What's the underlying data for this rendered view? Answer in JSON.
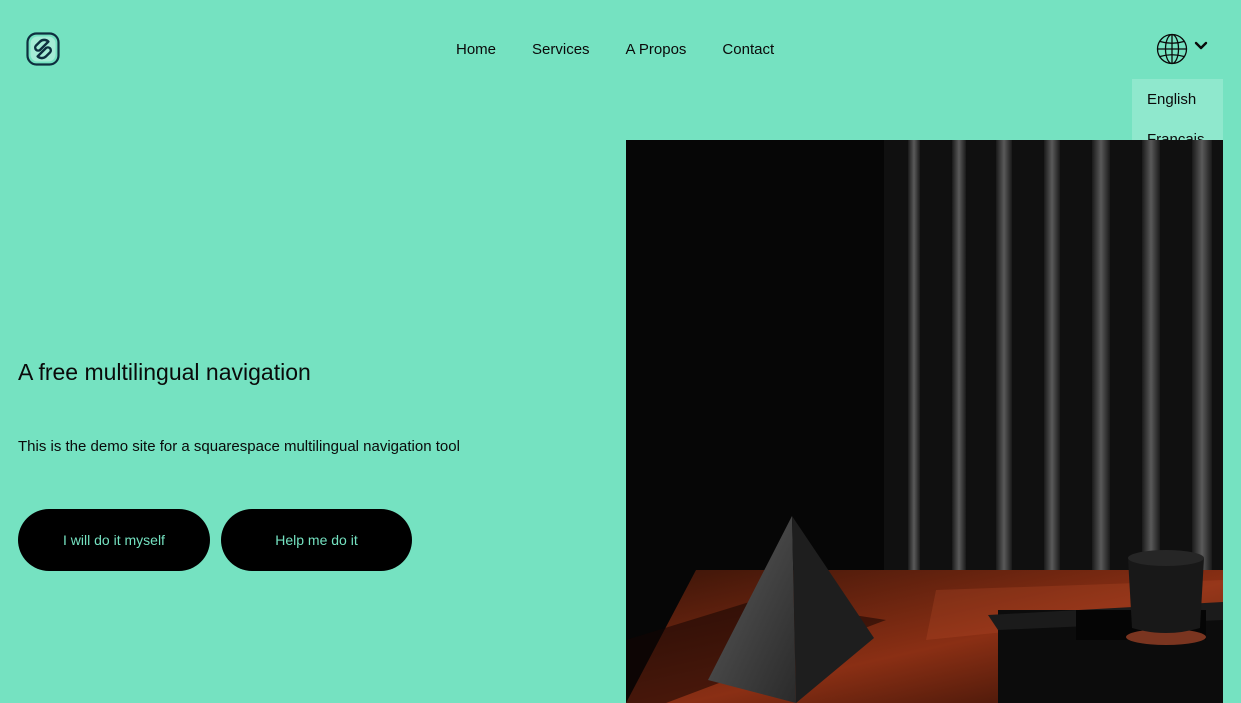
{
  "header": {
    "logo_icon": "squarespace-logo-icon",
    "nav": [
      {
        "label": "Home"
      },
      {
        "label": "Services"
      },
      {
        "label": "A Propos"
      },
      {
        "label": "Contact"
      }
    ],
    "language_toggle_icon": "globe-icon",
    "language_chevron_icon": "chevron-down-icon",
    "language_menu": [
      {
        "label": "English"
      },
      {
        "label": "Français"
      }
    ]
  },
  "hero": {
    "title": "A free multilingual navigation",
    "text": "This is the demo site for a squarespace multilingual navigation tool",
    "buttons": [
      {
        "label": "I will do it myself"
      },
      {
        "label": "Help me do it"
      }
    ],
    "image_icon": "pyramid-and-cup-photo"
  },
  "colors": {
    "background": "#75e2c1",
    "button_bg": "#000000",
    "button_text": "#75e2c1",
    "dropdown_bg": "#8fe8cd"
  }
}
